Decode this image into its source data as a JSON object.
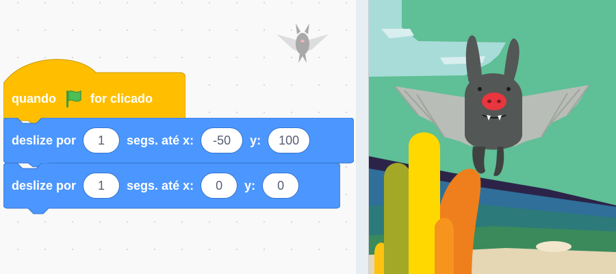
{
  "code_area": {
    "hat_block": {
      "label_before": "quando",
      "label_after": "for clicado",
      "icon": "green-flag-icon",
      "color": "#FFBF00"
    },
    "motion_blocks": [
      {
        "label_glide": "deslize por",
        "secs": "1",
        "label_to_x": "segs. até x:",
        "x": "-50",
        "label_y": "y:",
        "y": "100"
      },
      {
        "label_glide": "deslize por",
        "secs": "1",
        "label_to_x": "segs. até x:",
        "x": "0",
        "label_y": "y:",
        "y": "0"
      }
    ],
    "motion_color": "#4C97FF",
    "sprite_thumbnail": "bat-sprite-icon"
  },
  "stage": {
    "backdrop": "desert-backdrop",
    "sprite": "bat-sprite"
  }
}
